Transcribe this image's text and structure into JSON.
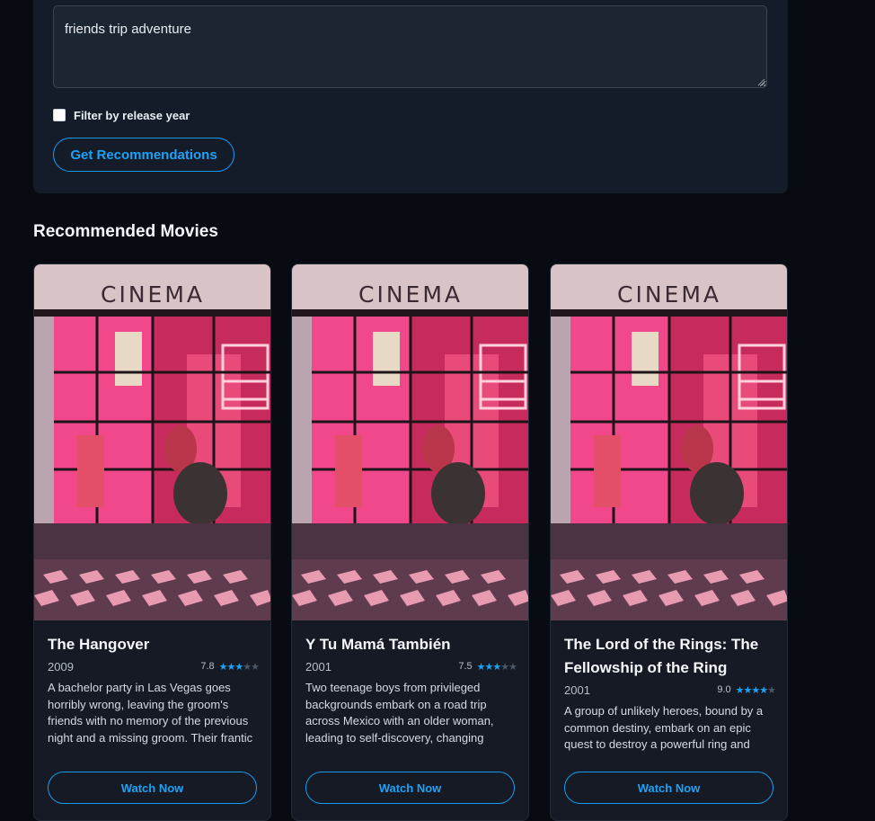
{
  "search": {
    "query_value": "friends trip adventure",
    "filter_label": "Filter by release year",
    "filter_checked": false,
    "submit_label": "Get Recommendations"
  },
  "results": {
    "heading": "Recommended Movies",
    "watch_label": "Watch Now",
    "poster_text": "CINEMA",
    "movies": [
      {
        "title": "The Hangover",
        "year": "2009",
        "rating": "7.8",
        "stars_filled": 3,
        "description": "A bachelor party in Las Vegas goes horribly wrong, leaving the groom's friends with no memory of the previous night and a missing groom. Their frantic search for him leads to hilarious and"
      },
      {
        "title": "Y Tu Mamá También",
        "year": "2001",
        "rating": "7.5",
        "stars_filled": 3,
        "description": "Two teenage boys from privileged backgrounds embark on a road trip across Mexico with an older woman, leading to self-discovery, changing friendships, and intense emotional"
      },
      {
        "title": "The Lord of the Rings: The Fellowship of the Ring",
        "year": "2001",
        "rating": "9.0",
        "stars_filled": 4,
        "description": "A group of unlikely heroes, bound by a common destiny, embark on an epic quest to destroy a powerful ring and"
      }
    ]
  },
  "colors": {
    "accent": "#1fa2f5",
    "background": "#090b12",
    "panel": "#131c28",
    "card": "#151a24"
  }
}
